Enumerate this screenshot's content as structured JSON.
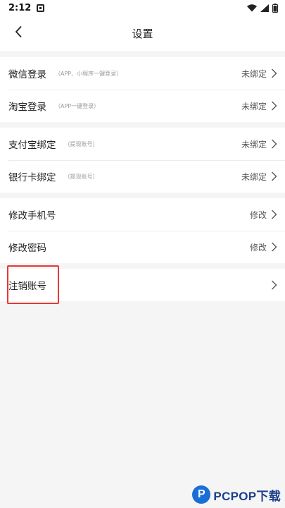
{
  "status_bar": {
    "time": "2:12"
  },
  "nav": {
    "title": "设置"
  },
  "groups": [
    {
      "rows": [
        {
          "label": "微信登录",
          "hint": "（APP、小程序一键登录）",
          "value": "未绑定"
        },
        {
          "label": "淘宝登录",
          "hint": "（APP一键登录）",
          "value": "未绑定"
        }
      ]
    },
    {
      "rows": [
        {
          "label": "支付宝绑定",
          "hint": "（提现账号）",
          "value": "未绑定"
        },
        {
          "label": "银行卡绑定",
          "hint": "（提现账号）",
          "value": "未绑定"
        }
      ]
    },
    {
      "rows": [
        {
          "label": "修改手机号",
          "hint": "",
          "value": "修改"
        },
        {
          "label": "修改密码",
          "hint": "",
          "value": "修改"
        }
      ]
    },
    {
      "rows": [
        {
          "label": "注销账号",
          "hint": "",
          "value": ""
        }
      ]
    }
  ],
  "watermark": {
    "logo_letter": "P",
    "brand": "PCPOP下载"
  },
  "colors": {
    "highlight": "#e53935",
    "brand": "#1a6fd6"
  }
}
